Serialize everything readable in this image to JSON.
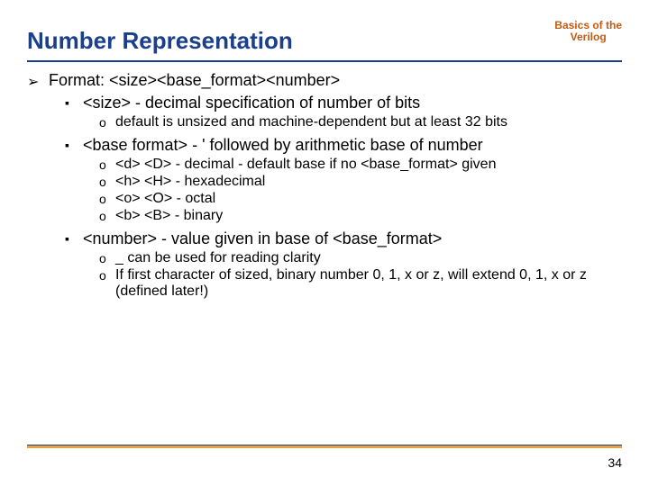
{
  "header": {
    "title": "Number Representation",
    "subtitle_line1": "Basics of the",
    "subtitle_line2": "Verilog"
  },
  "content": {
    "format_line": "Format: <size><base_format><number>",
    "items": [
      {
        "text": "<size>  - decimal specification of number of bits",
        "sub": [
          "default is unsized and machine-dependent but at least 32 bits"
        ]
      },
      {
        "text": "<base format>  - ' followed by arithmetic base of number",
        "sub": [
          "<d> <D> - decimal - default base if no <base_format> given",
          "<h> <H> - hexadecimal",
          "<o> <O> - octal",
          "<b> <B> - binary"
        ]
      },
      {
        "text": "<number> - value given in base of <base_format>",
        "sub": [
          "_ can be used for reading clarity",
          "If first character of sized, binary number 0, 1, x or z, will extend 0, 1, x or z (defined later!)"
        ]
      }
    ]
  },
  "page_number": "34"
}
